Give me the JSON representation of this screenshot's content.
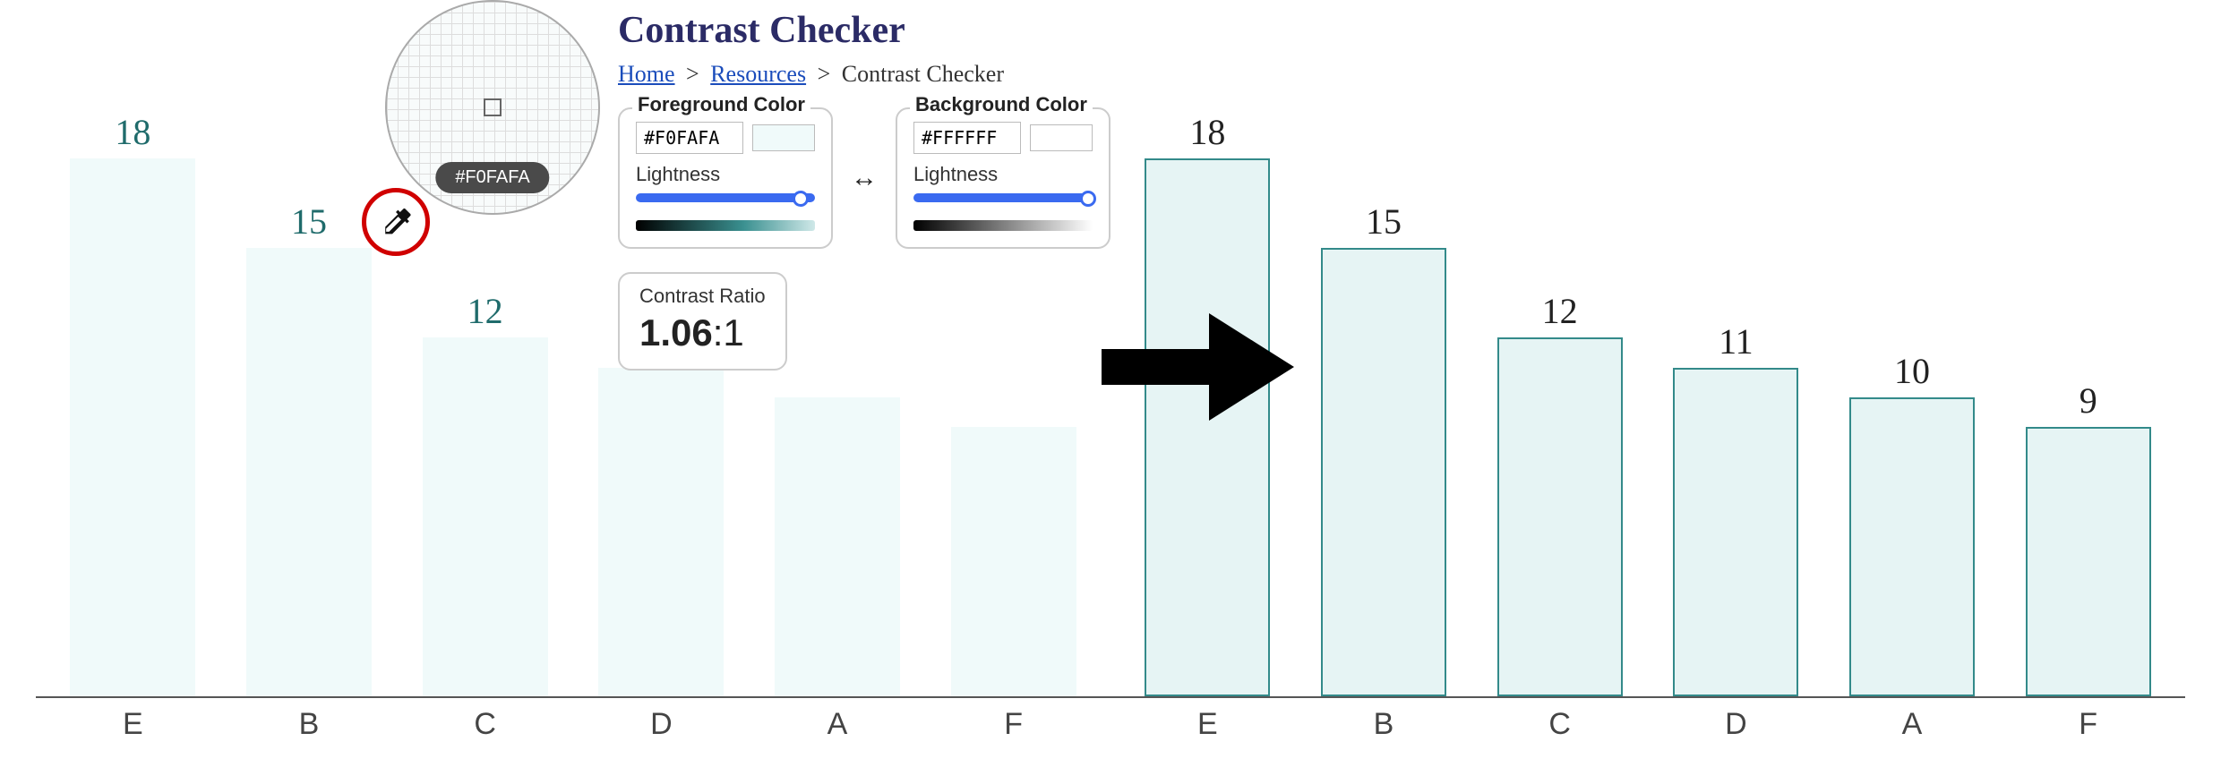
{
  "chart_data": [
    {
      "type": "bar",
      "title": "",
      "xlabel": "",
      "ylabel": "",
      "ylim": [
        0,
        20
      ],
      "categories": [
        "E",
        "B",
        "C",
        "D",
        "A",
        "F"
      ],
      "values": [
        18,
        15,
        12,
        11,
        10,
        9
      ],
      "bar_fill": "#f0fafa",
      "bar_border": null,
      "contrast_issue": true
    },
    {
      "type": "bar",
      "title": "",
      "xlabel": "",
      "ylabel": "",
      "ylim": [
        0,
        20
      ],
      "categories": [
        "E",
        "B",
        "C",
        "D",
        "A",
        "F"
      ],
      "values": [
        18,
        15,
        12,
        11,
        10,
        9
      ],
      "bar_fill": "#e6f4f4",
      "bar_border": "#338a8a",
      "contrast_issue": false
    }
  ],
  "tool": {
    "title": "Contrast Checker",
    "breadcrumb": {
      "home": "Home",
      "resources": "Resources",
      "current": "Contrast Checker"
    },
    "magnifier_hex": "#F0FAFA",
    "foreground": {
      "label": "Foreground Color",
      "hex": "#F0FAFA",
      "lightness_label": "Lightness",
      "thumb_pct": 92
    },
    "background": {
      "label": "Background Color",
      "hex": "#FFFFFF",
      "lightness_label": "Lightness",
      "thumb_pct": 100
    },
    "ratio": {
      "label": "Contrast Ratio",
      "bold": "1.06",
      "rest": ":1"
    }
  }
}
